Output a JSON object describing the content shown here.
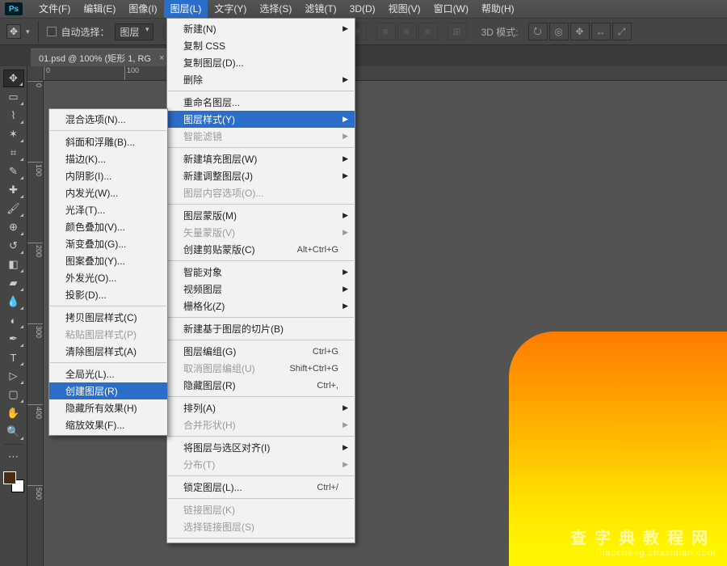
{
  "app": {
    "logo": "Ps"
  },
  "menubar": [
    {
      "label": "文件(F)"
    },
    {
      "label": "编辑(E)"
    },
    {
      "label": "图像(I)"
    },
    {
      "label": "图层(L)",
      "open": true
    },
    {
      "label": "文字(Y)"
    },
    {
      "label": "选择(S)"
    },
    {
      "label": "滤镜(T)"
    },
    {
      "label": "3D(D)"
    },
    {
      "label": "视图(V)"
    },
    {
      "label": "窗口(W)"
    },
    {
      "label": "帮助(H)"
    }
  ],
  "options": {
    "auto_select_label": "自动选择：",
    "auto_select_target": "图层",
    "mode_3d_label": "3D 模式:"
  },
  "doctab": {
    "title": "01.psd @ 100% (矩形 1, RG",
    "close": "×",
    "expand": "»"
  },
  "ruler_x": [
    "0",
    "100"
  ],
  "ruler_y": [
    "0",
    "100",
    "200",
    "300",
    "400",
    "500"
  ],
  "layer_menu": [
    {
      "t": "新建(N)",
      "sub": true
    },
    {
      "t": "复制 CSS"
    },
    {
      "t": "复制图层(D)..."
    },
    {
      "t": "删除",
      "sub": true
    },
    {
      "sep": true
    },
    {
      "t": "重命名图层..."
    },
    {
      "t": "图层样式(Y)",
      "sub": true,
      "hi": true
    },
    {
      "t": "智能滤镜",
      "sub": true,
      "dis": true
    },
    {
      "sep": true
    },
    {
      "t": "新建填充图层(W)",
      "sub": true
    },
    {
      "t": "新建调整图层(J)",
      "sub": true
    },
    {
      "t": "图层内容选项(O)...",
      "dis": true
    },
    {
      "sep": true
    },
    {
      "t": "图层蒙版(M)",
      "sub": true
    },
    {
      "t": "矢量蒙版(V)",
      "sub": true,
      "dis": true
    },
    {
      "t": "创建剪贴蒙版(C)",
      "sc": "Alt+Ctrl+G"
    },
    {
      "sep": true
    },
    {
      "t": "智能对象",
      "sub": true
    },
    {
      "t": "视频图层",
      "sub": true
    },
    {
      "t": "栅格化(Z)",
      "sub": true
    },
    {
      "sep": true
    },
    {
      "t": "新建基于图层的切片(B)"
    },
    {
      "sep": true
    },
    {
      "t": "图层编组(G)",
      "sc": "Ctrl+G"
    },
    {
      "t": "取消图层编组(U)",
      "sc": "Shift+Ctrl+G",
      "dis": true
    },
    {
      "t": "隐藏图层(R)",
      "sc": "Ctrl+,"
    },
    {
      "sep": true
    },
    {
      "t": "排列(A)",
      "sub": true
    },
    {
      "t": "合并形状(H)",
      "sub": true,
      "dis": true
    },
    {
      "sep": true
    },
    {
      "t": "将图层与选区对齐(I)",
      "sub": true
    },
    {
      "t": "分布(T)",
      "sub": true,
      "dis": true
    },
    {
      "sep": true
    },
    {
      "t": "锁定图层(L)...",
      "sc": "Ctrl+/"
    },
    {
      "sep": true
    },
    {
      "t": "链接图层(K)",
      "dis": true
    },
    {
      "t": "选择链接图层(S)",
      "dis": true
    },
    {
      "sep": true
    }
  ],
  "style_submenu": [
    {
      "t": "混合选项(N)..."
    },
    {
      "sep": true
    },
    {
      "t": "斜面和浮雕(B)..."
    },
    {
      "t": "描边(K)..."
    },
    {
      "t": "内阴影(I)..."
    },
    {
      "t": "内发光(W)..."
    },
    {
      "t": "光泽(T)..."
    },
    {
      "t": "颜色叠加(V)..."
    },
    {
      "t": "渐变叠加(G)..."
    },
    {
      "t": "图案叠加(Y)..."
    },
    {
      "t": "外发光(O)..."
    },
    {
      "t": "投影(D)..."
    },
    {
      "sep": true
    },
    {
      "t": "拷贝图层样式(C)"
    },
    {
      "t": "粘贴图层样式(P)",
      "dis": true
    },
    {
      "t": "清除图层样式(A)"
    },
    {
      "sep": true
    },
    {
      "t": "全局光(L)..."
    },
    {
      "t": "创建图层(R)",
      "hi": true
    },
    {
      "t": "隐藏所有效果(H)"
    },
    {
      "t": "缩放效果(F)..."
    }
  ],
  "watermark": {
    "line1": "查字典教程网",
    "line2": "jiaocheng.chazidian.com"
  }
}
